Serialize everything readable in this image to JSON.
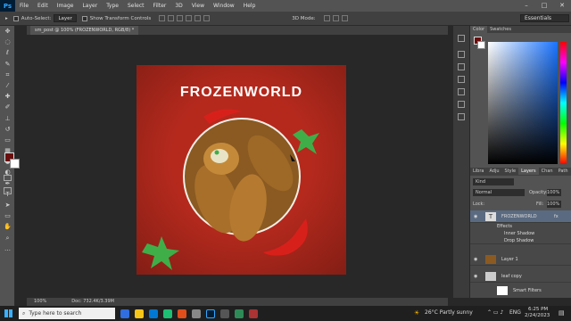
{
  "app": {
    "logo": "Ps"
  },
  "menus": [
    "File",
    "Edit",
    "Image",
    "Layer",
    "Type",
    "Select",
    "Filter",
    "3D",
    "View",
    "Window",
    "Help"
  ],
  "window_controls": [
    "–",
    "□",
    "✕"
  ],
  "options": {
    "auto_select_label": "Auto-Select:",
    "auto_select_value": "Layer",
    "transform_label": "Show Transform Controls",
    "mode_3d": "3D Mode:",
    "workspace": "Essentials"
  },
  "document_tab": "sm_post @ 100% (FROZENWORLD, RGB/8) *",
  "artboard": {
    "title": "FROZENWORLD",
    "colors": {
      "bg": "#b5291d",
      "leaf": "#3fae49",
      "chili": "#d8201b"
    }
  },
  "status": {
    "zoom": "100%",
    "doc": "Doc: 732.4K/3.39M"
  },
  "panel": {
    "top_tabs": [
      "Color",
      "Swatches"
    ],
    "mid_tabs": [
      "Libra",
      "Adju",
      "Style",
      "Layers",
      "Chan",
      "Path"
    ],
    "kind": "Kind",
    "blend": "Normal",
    "opacity_label": "Opacity:",
    "opacity_value": "100%",
    "lock_label": "Lock:",
    "fill_label": "Fill:",
    "fill_value": "100%",
    "layers": [
      "FROZENWORLD",
      "Effects",
      "Inner Shadow",
      "Drop Shadow",
      "Layer 1",
      "leaf copy",
      "Smart Filters"
    ],
    "fx": "fx"
  },
  "taskbar": {
    "search_placeholder": "Type here to search",
    "weather": "26°C  Partly sunny",
    "lang": "ENG",
    "time": "6:25 PM",
    "date": "2/24/2023"
  }
}
